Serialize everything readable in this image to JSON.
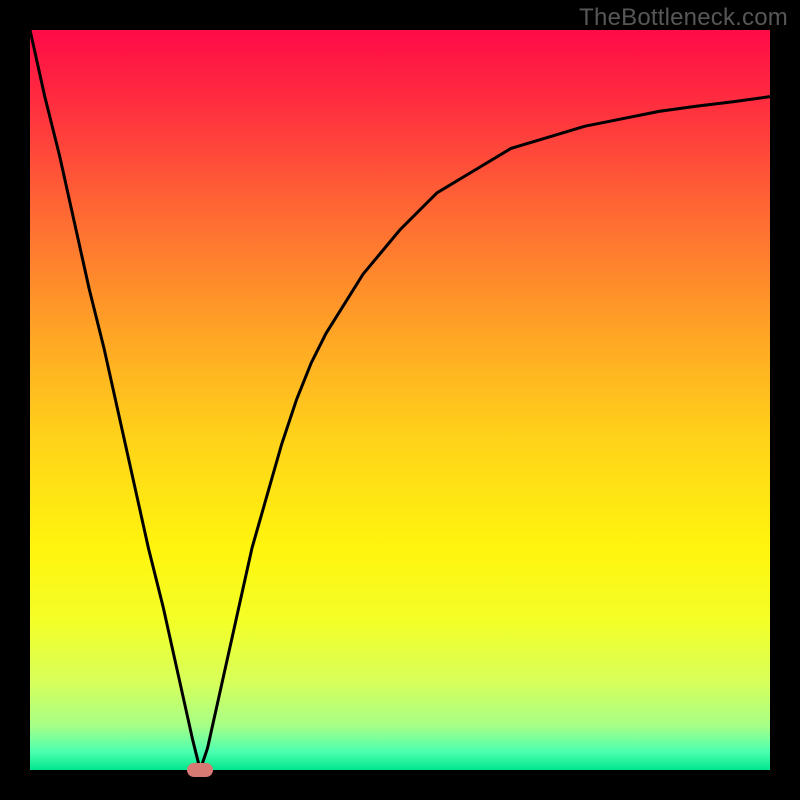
{
  "watermark": "TheBottleneck.com",
  "colors": {
    "frame": "#000000",
    "curve": "#000000",
    "marker": "#d77a74",
    "gradient_stops": [
      {
        "offset": 0.0,
        "color": "#ff0b47"
      },
      {
        "offset": 0.1,
        "color": "#ff2e3f"
      },
      {
        "offset": 0.25,
        "color": "#ff6a33"
      },
      {
        "offset": 0.4,
        "color": "#ffa126"
      },
      {
        "offset": 0.55,
        "color": "#ffd21a"
      },
      {
        "offset": 0.7,
        "color": "#fff50e"
      },
      {
        "offset": 0.8,
        "color": "#f3ff28"
      },
      {
        "offset": 0.88,
        "color": "#d8ff5a"
      },
      {
        "offset": 0.94,
        "color": "#a6ff86"
      },
      {
        "offset": 0.975,
        "color": "#4dffb0"
      },
      {
        "offset": 1.0,
        "color": "#00e68c"
      }
    ]
  },
  "chart_data": {
    "type": "line",
    "title": "",
    "xlabel": "",
    "ylabel": "",
    "xlim": [
      0,
      100
    ],
    "ylim": [
      0,
      100
    ],
    "grid": false,
    "legend": false,
    "series": [
      {
        "name": "bottleneck-curve",
        "x": [
          0,
          2,
          4,
          6,
          8,
          10,
          12,
          14,
          16,
          18,
          20,
          22,
          23,
          24,
          26,
          28,
          30,
          32,
          34,
          36,
          38,
          40,
          45,
          50,
          55,
          60,
          65,
          70,
          75,
          80,
          85,
          90,
          95,
          100
        ],
        "y": [
          100,
          91,
          83,
          74,
          65,
          57,
          48,
          39,
          30,
          22,
          13,
          4,
          0,
          3,
          12,
          21,
          30,
          37,
          44,
          50,
          55,
          59,
          67,
          73,
          78,
          81,
          84,
          85.5,
          87,
          88,
          89,
          89.7,
          90.3,
          91
        ]
      }
    ],
    "annotations": [
      {
        "name": "optimal-marker",
        "x": 23,
        "y": 0
      }
    ]
  }
}
